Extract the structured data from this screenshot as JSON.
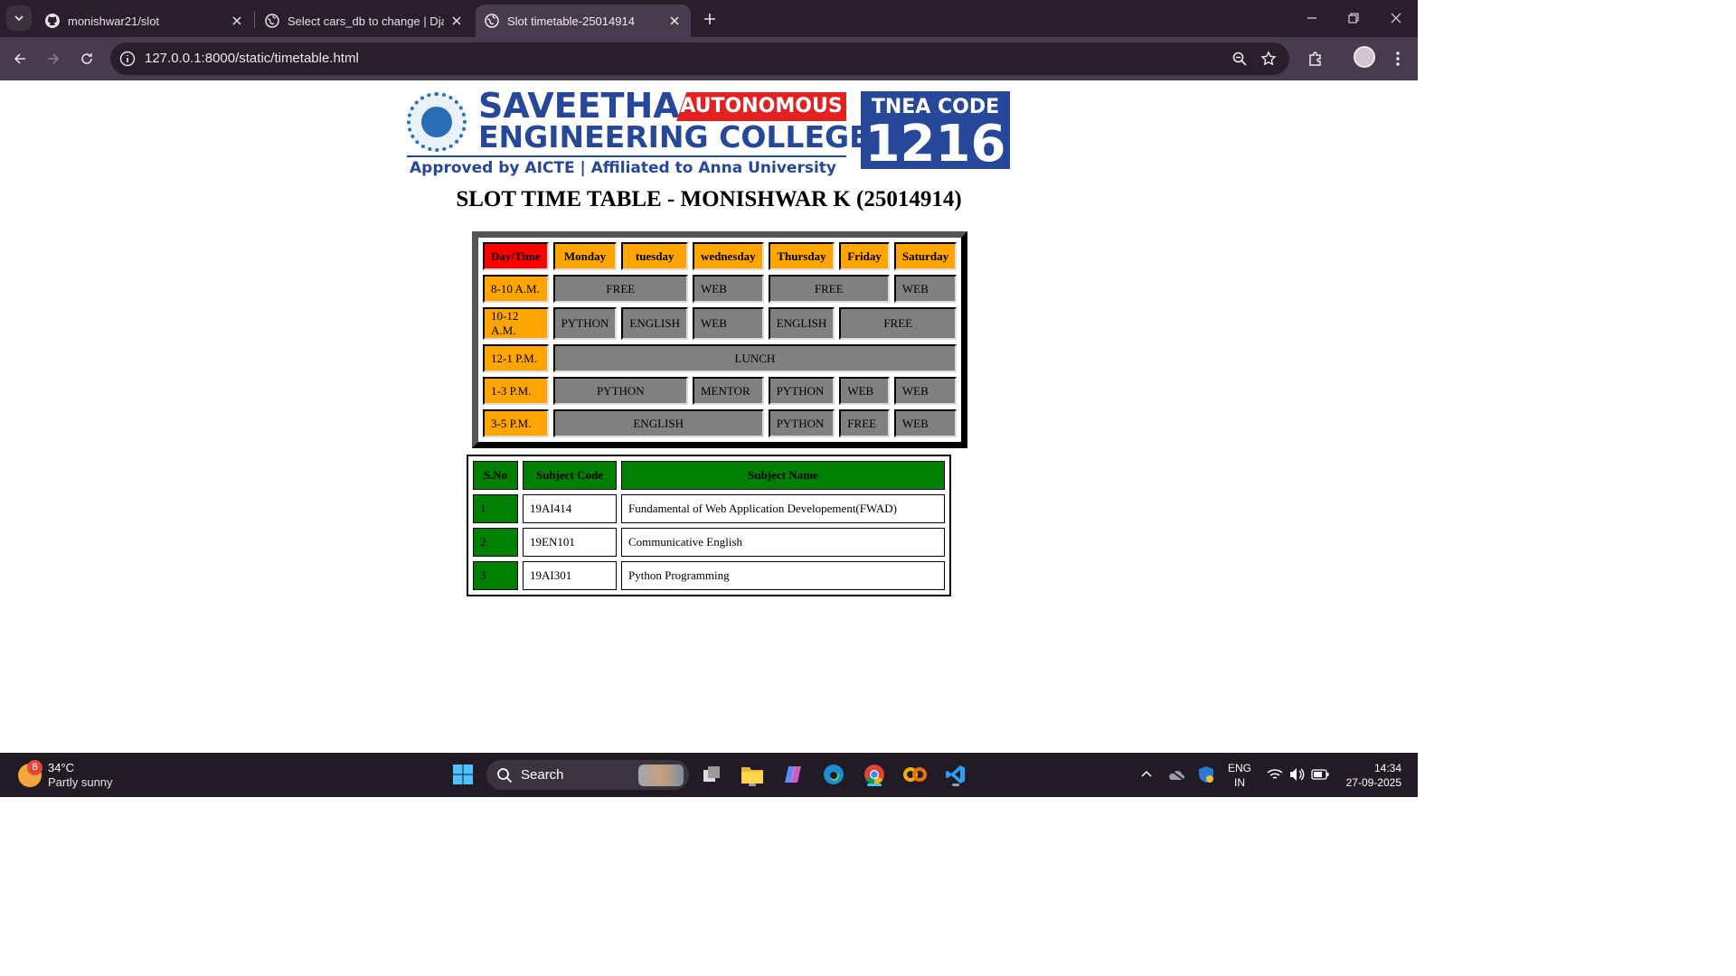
{
  "browser": {
    "tabs": [
      {
        "title": "monishwar21/slot",
        "icon": "github-icon",
        "active": false
      },
      {
        "title": "Select cars_db to change | Djan",
        "icon": "globe-icon",
        "active": false
      },
      {
        "title": "Slot timetable-25014914",
        "icon": "globe-icon",
        "active": true
      }
    ],
    "url": "127.0.0.1:8000/static/timetable.html"
  },
  "page": {
    "logo": {
      "name_line1": "SAVEETHA",
      "autonomous": "AUTONOMOUS",
      "name_line2": "ENGINEERING COLLEGE",
      "tagline": "Approved by AICTE  |  Affiliated to Anna University",
      "tnea_label": "TNEA CODE",
      "tnea_code": "1216"
    },
    "heading": "SLOT TIME TABLE - MONISHWAR K (25014914)",
    "timetable": {
      "corner": "Day/Time",
      "days": [
        "Monday",
        "tuesday",
        "wednesday",
        "Thursday",
        "Friday",
        "Saturday"
      ],
      "rows": [
        {
          "time": "8-10 A.M.",
          "cells": [
            "FREE",
            "WEB",
            "FREE",
            "WEB"
          ]
        },
        {
          "time": "10-12 A.M.",
          "cells": [
            "PYTHON",
            "ENGLISH",
            "WEB",
            "ENGLISH",
            "FREE"
          ]
        },
        {
          "time": "12-1 P.M.",
          "cells": [
            "LUNCH"
          ]
        },
        {
          "time": "1-3 P.M.",
          "cells": [
            "PYTHON",
            "MENTOR",
            "PYTHON",
            "WEB",
            "WEB"
          ]
        },
        {
          "time": "3-5 P.M.",
          "cells": [
            "ENGLISH",
            "PYTHON",
            "FREE",
            "WEB"
          ]
        }
      ]
    },
    "subjects": {
      "headers": [
        "S.No",
        "Subject Code",
        "Subject Name"
      ],
      "rows": [
        {
          "sno": "1",
          "code": "19AI414",
          "name": "Fundamental of Web Application Developement(FWAD)"
        },
        {
          "sno": "2",
          "code": "19EN101",
          "name": "Communicative English"
        },
        {
          "sno": "3",
          "code": "19AI301",
          "name": "Python Programming"
        }
      ]
    }
  },
  "taskbar": {
    "weather": {
      "badge": "8",
      "temp": "34°C",
      "condition": "Partly sunny"
    },
    "search_placeholder": "Search",
    "apps": [
      "start-icon",
      "search-icon",
      "task-view-icon",
      "file-explorer-icon",
      "copilot-icon",
      "edge-icon",
      "chrome-icon",
      "colab-icon",
      "vscode-icon"
    ],
    "lang_line1": "ENG",
    "lang_line2": "IN",
    "time": "14:34",
    "date": "27-09-2025"
  },
  "colors": {
    "chrome_dark": "#2b1d2e",
    "chrome_toolbar": "#4a3a4d",
    "header_orange": "#ffa500",
    "corner_red": "#ff0000",
    "slot_gray": "#808080",
    "subject_green": "#008000",
    "logo_blue": "#27479a"
  }
}
